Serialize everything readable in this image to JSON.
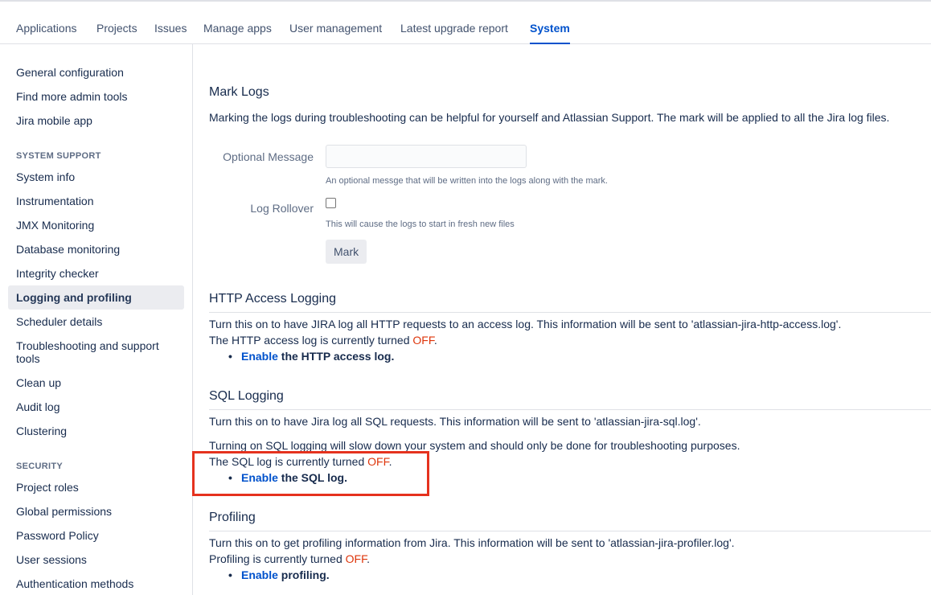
{
  "tabs": [
    "Applications",
    "Projects",
    "Issues",
    "Manage apps",
    "User management",
    "Latest upgrade report",
    "System"
  ],
  "active_tab": "System",
  "sidebar": {
    "top_items": [
      "General configuration",
      "Find more admin tools",
      "Jira mobile app"
    ],
    "system_support_heading": "SYSTEM SUPPORT",
    "system_support_items": [
      "System info",
      "Instrumentation",
      "JMX Monitoring",
      "Database monitoring",
      "Integrity checker",
      "Logging and profiling",
      "Scheduler details",
      "Troubleshooting and support tools",
      "Clean up",
      "Audit log",
      "Clustering"
    ],
    "security_heading": "SECURITY",
    "security_items": [
      "Project roles",
      "Global permissions",
      "Password Policy",
      "User sessions",
      "Authentication methods"
    ]
  },
  "mark_logs": {
    "title": "Mark Logs",
    "description": "Marking the logs during troubleshooting can be helpful for yourself and Atlassian Support. The mark will be applied to all the Jira log files.",
    "optional_message_label": "Optional Message",
    "optional_message_value": "",
    "optional_message_help": "An optional messge that will be written into the logs along with the mark.",
    "log_rollover_label": "Log Rollover",
    "log_rollover_help": "This will cause the logs to start in fresh new files",
    "mark_button": "Mark"
  },
  "http_logging": {
    "title": "HTTP Access Logging",
    "description": "Turn this on to have JIRA log all HTTP requests to an access log. This information will be sent to 'atlassian-jira-http-access.log'.",
    "status_prefix": "The HTTP access log is currently turned ",
    "status_value": "OFF",
    "status_suffix": ".",
    "enable_link": "Enable",
    "enable_rest": " the HTTP access log."
  },
  "sql_logging": {
    "title": "SQL Logging",
    "description": "Turn this on to have Jira log all SQL requests. This information will be sent to 'atlassian-jira-sql.log'.",
    "warning": "Turning on SQL logging will slow down your system and should only be done for troubleshooting purposes.",
    "status_prefix": "The SQL log is currently turned ",
    "status_value": "OFF",
    "status_suffix": ".",
    "enable_link": "Enable",
    "enable_rest": " the SQL log."
  },
  "profiling": {
    "title": "Profiling",
    "description": "Turn this on to get profiling information from Jira. This information will be sent to 'atlassian-jira-profiler.log'.",
    "status_prefix": "Profiling is currently turned ",
    "status_value": "OFF",
    "status_suffix": ".",
    "enable_link": "Enable",
    "enable_rest": " profiling."
  },
  "colors": {
    "link": "#0052cc",
    "off": "#de350b",
    "highlight_box": "#e5321e"
  }
}
